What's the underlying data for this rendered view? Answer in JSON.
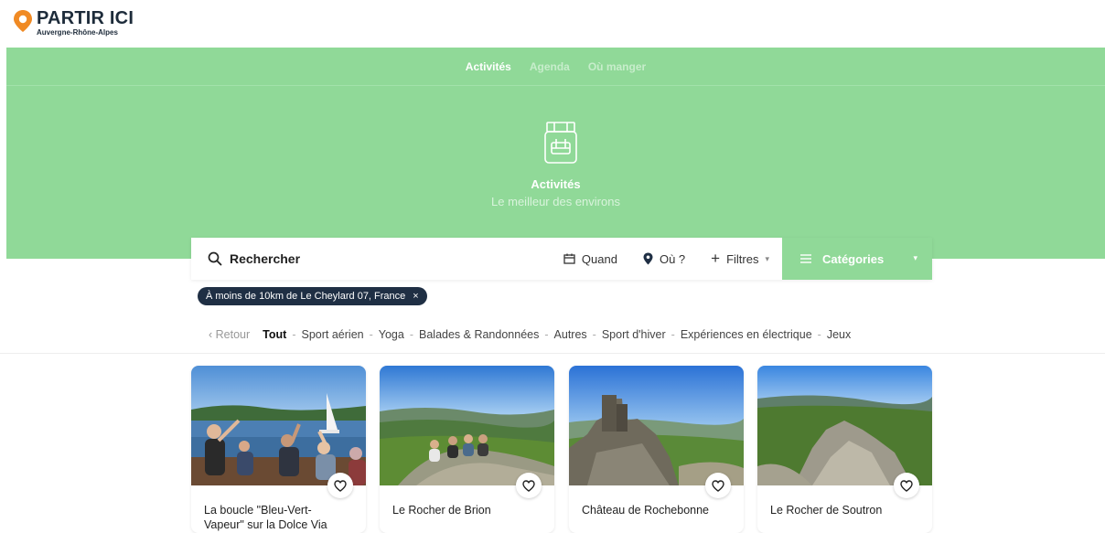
{
  "brand": {
    "title": "PARTIR ICI",
    "subtitle": "Auvergne-Rhône-Alpes",
    "colors": {
      "pin": "#f08a24",
      "dark": "#1d2b3a"
    }
  },
  "hero": {
    "nav": [
      {
        "label": "Activités",
        "active": true
      },
      {
        "label": "Agenda",
        "active": false
      },
      {
        "label": "Où manger",
        "active": false
      }
    ],
    "icon": "backpack-icon",
    "title": "Activités",
    "subtitle": "Le meilleur des environs",
    "color": "#90d998"
  },
  "search": {
    "label": "Rechercher",
    "when": "Quand",
    "where": "Où ?",
    "filters": "Filtres",
    "categories": "Catégories"
  },
  "chip": {
    "label": "À moins de 10km de Le Cheylard 07, France",
    "close": "×"
  },
  "categories": {
    "back": "Retour",
    "items": [
      {
        "label": "Tout",
        "active": true
      },
      {
        "label": "Sport aérien",
        "active": false
      },
      {
        "label": "Yoga",
        "active": false
      },
      {
        "label": "Balades & Randonnées",
        "active": false
      },
      {
        "label": "Autres",
        "active": false
      },
      {
        "label": "Sport d'hiver",
        "active": false
      },
      {
        "label": "Expériences en électrique",
        "active": false
      },
      {
        "label": "Jeux",
        "active": false
      }
    ]
  },
  "cards": [
    {
      "title": "La boucle \"Bleu-Vert-Vapeur\" sur la Dolce Via"
    },
    {
      "title": "Le Rocher de Brion"
    },
    {
      "title": "Château de Rochebonne"
    },
    {
      "title": "Le Rocher de Soutron"
    }
  ]
}
